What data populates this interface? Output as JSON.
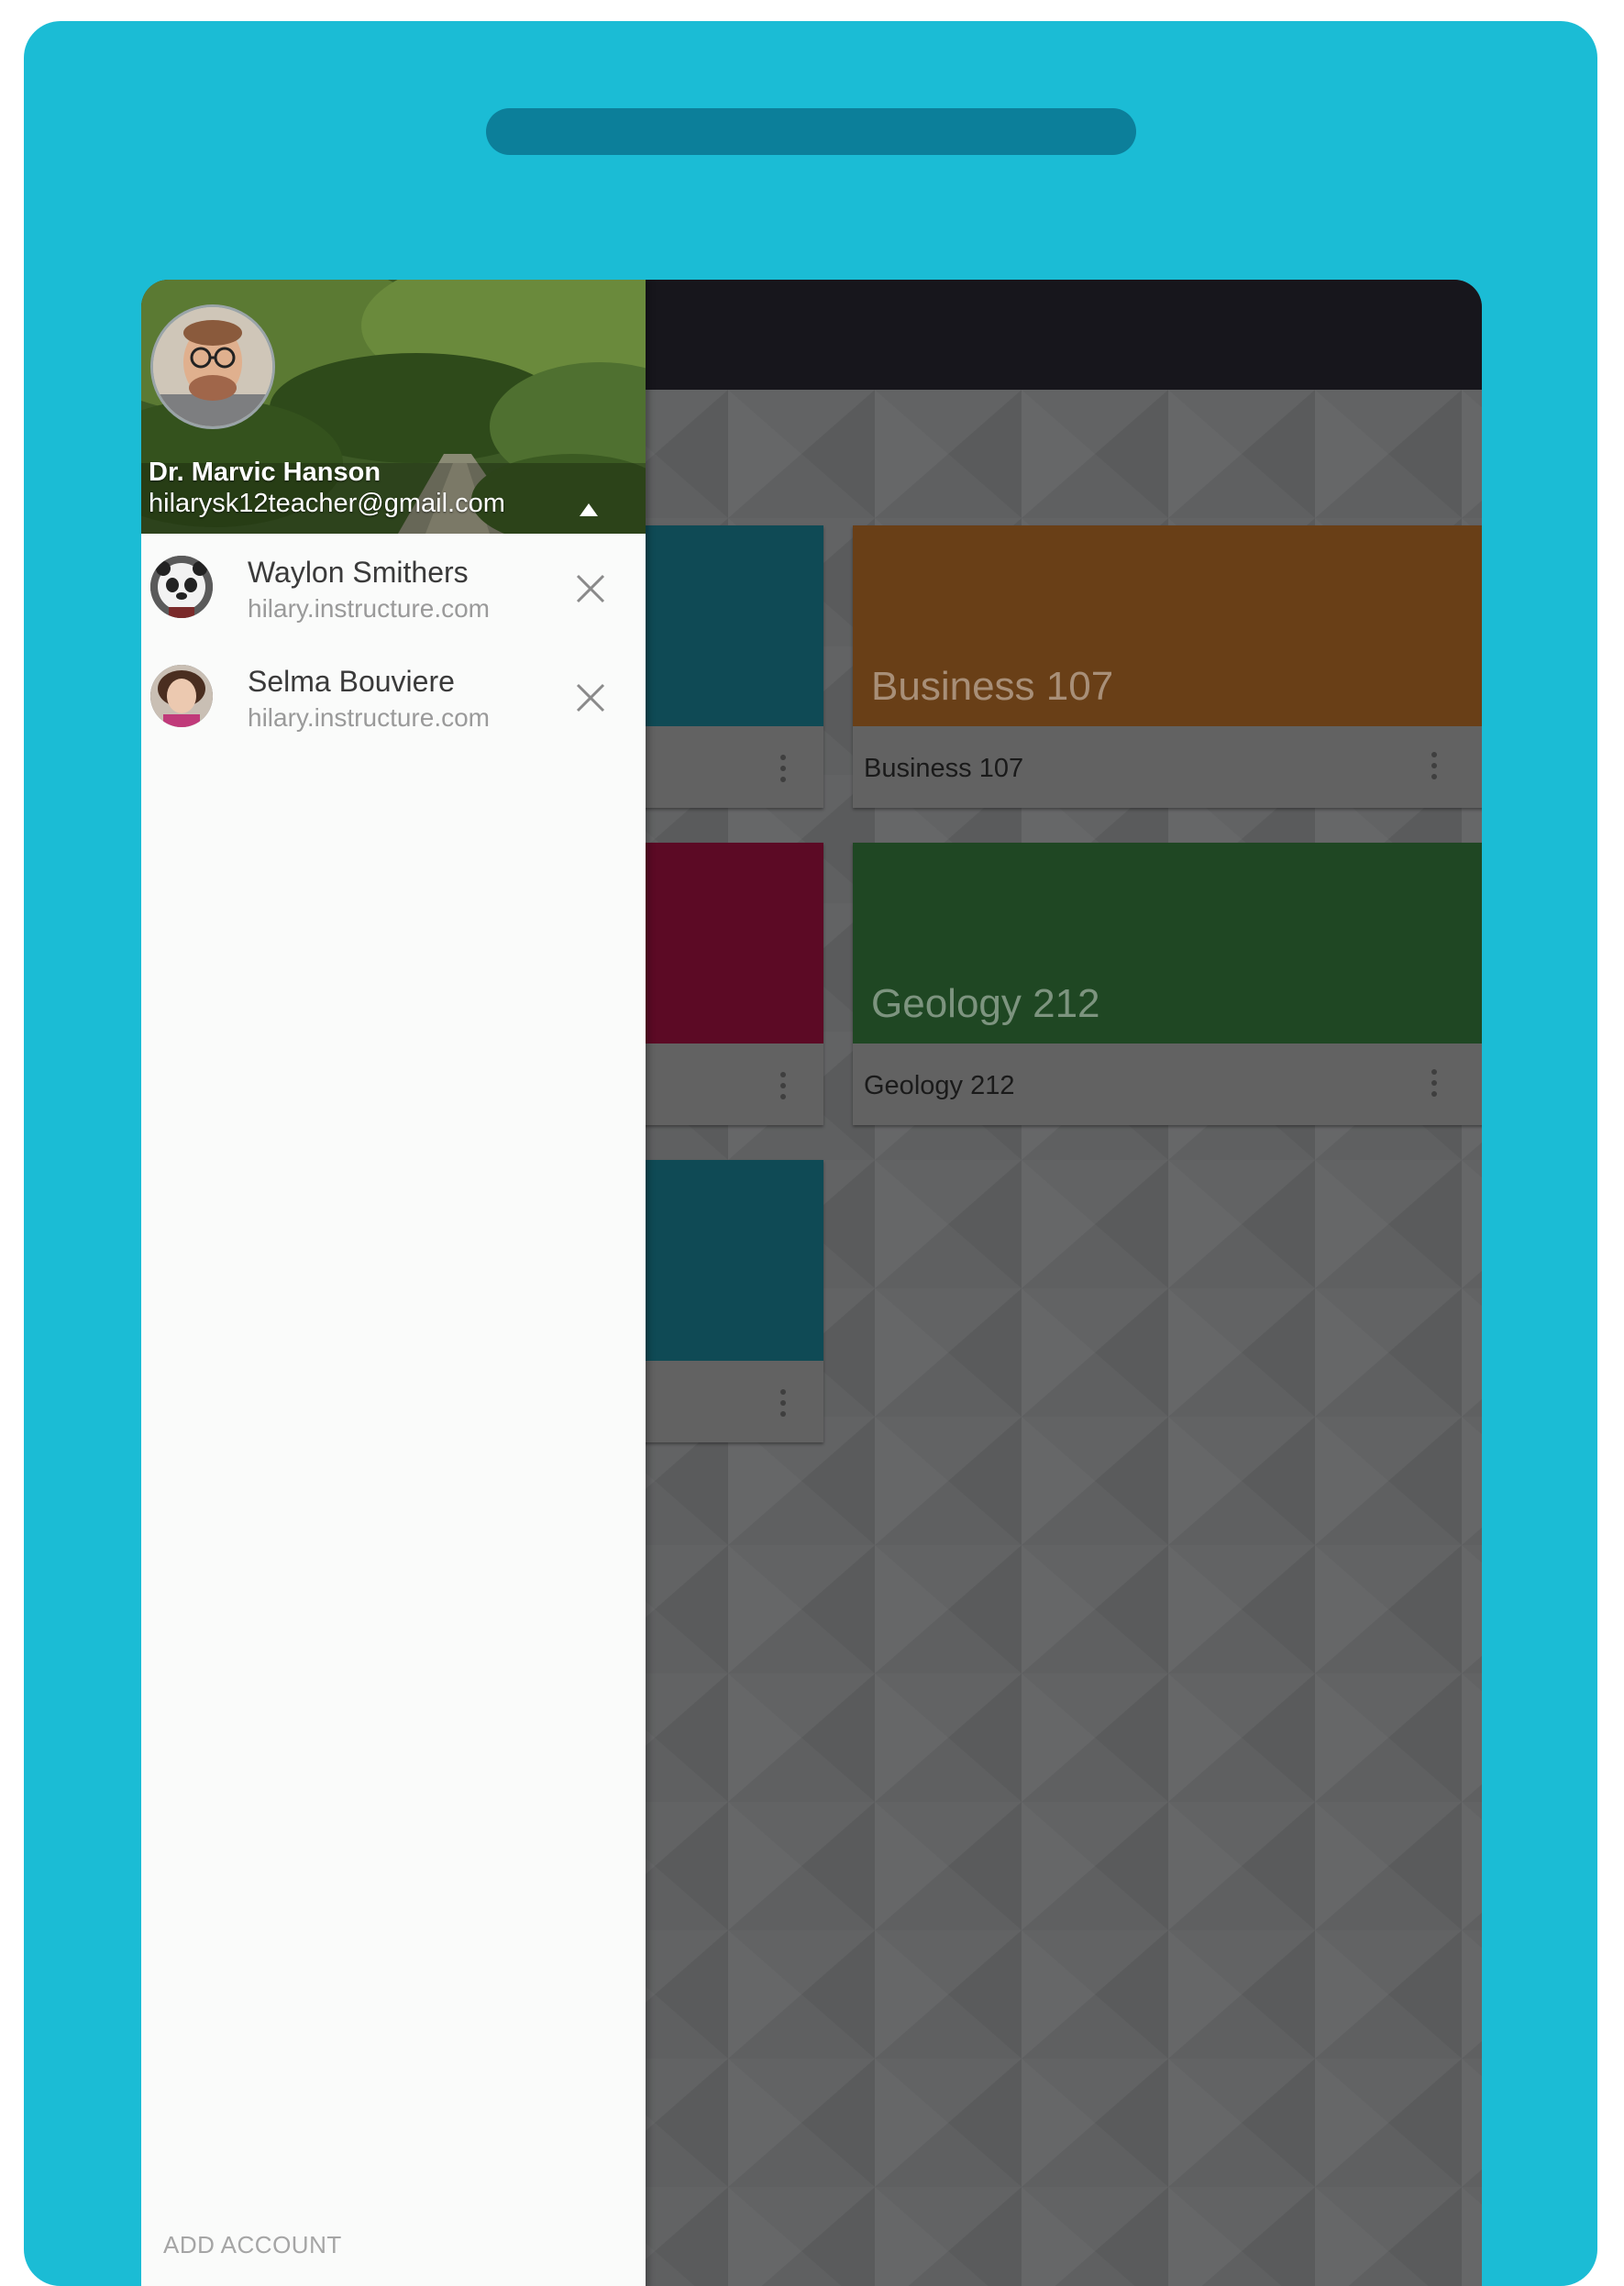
{
  "drawer": {
    "profile": {
      "name": "Dr. Marvic Hanson",
      "email": "hilarysk12teacher@gmail.com"
    },
    "accounts": [
      {
        "name": "Waylon Smithers",
        "domain": "hilary.instructure.com"
      },
      {
        "name": "Selma Bouviere",
        "domain": "hilary.instructure.com"
      }
    ],
    "add_account_label": "ADD ACCOUNT"
  },
  "courses": [
    {
      "title": "Business 107",
      "subtitle": "Business 107",
      "color": "#693f17"
    },
    {
      "title": "Geology 212",
      "subtitle": "Geology 212",
      "color": "#1f4723"
    }
  ],
  "partial_cards": [
    {
      "color": "#0f4a55"
    },
    {
      "color": "#5c0a25"
    },
    {
      "color": "#0f4a55"
    }
  ],
  "colors": {
    "device_frame": "#1bbcd5",
    "toolbar": "#17161c",
    "scrim_background": "#5f6061"
  }
}
